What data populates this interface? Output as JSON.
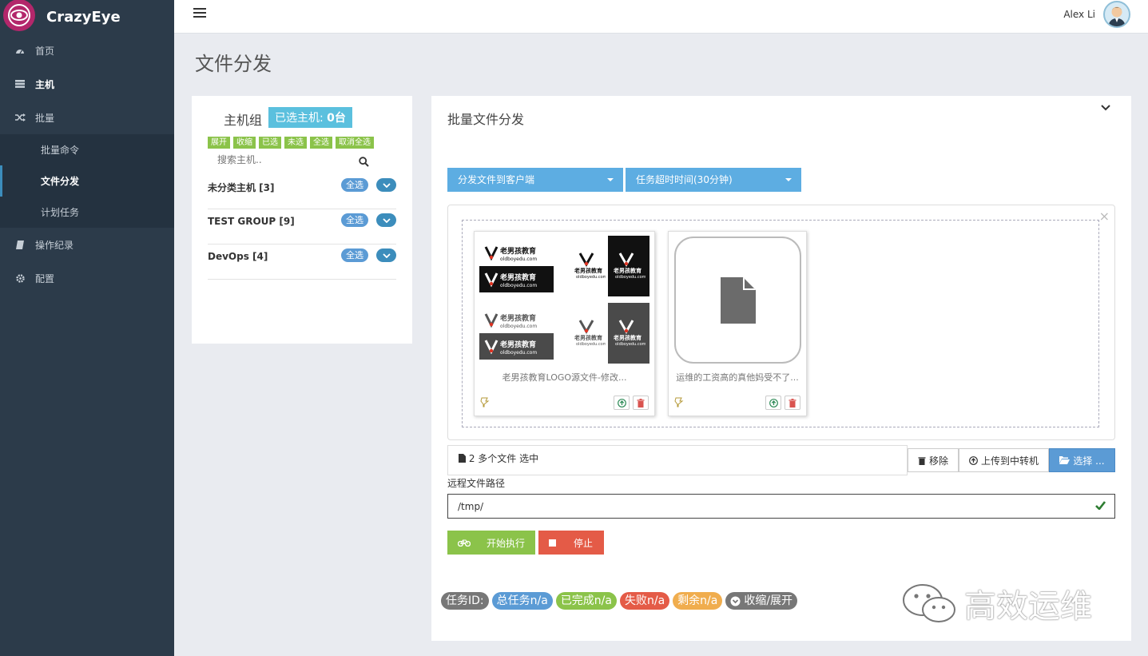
{
  "brand": {
    "name": "CrazyEye",
    "logo_color": "#b3276b"
  },
  "sidebar": {
    "items": [
      {
        "label": "首页",
        "icon": "dashboard-icon"
      },
      {
        "label": "主机",
        "icon": "server-icon"
      },
      {
        "label": "批量",
        "icon": "shuffle-icon"
      },
      {
        "label": "操作纪录",
        "icon": "book-icon"
      },
      {
        "label": "配置",
        "icon": "gear-icon"
      }
    ],
    "sub_items": [
      {
        "label": "批量命令"
      },
      {
        "label": "文件分发"
      },
      {
        "label": "计划任务"
      }
    ]
  },
  "topbar": {
    "user_name": "Alex Li"
  },
  "page": {
    "title": "文件分发"
  },
  "host_panel": {
    "title": "主机组",
    "selected_label": "已选主机:",
    "selected_count": "0台",
    "quick_buttons": [
      "展开",
      "收缩",
      "已选",
      "未选",
      "全选",
      "取消全选"
    ],
    "search_placeholder": "搜索主机..",
    "groups": [
      {
        "name": "未分类主机 [3]",
        "select_all": "全选"
      },
      {
        "name": "TEST GROUP [9]",
        "select_all": "全选"
      },
      {
        "name": "DevOps [4]",
        "select_all": "全选"
      }
    ]
  },
  "main_panel": {
    "title": "批量文件分发",
    "mode_select": "分发文件到客户端",
    "timeout_select": "任务超时时间(30分钟)",
    "files": [
      {
        "caption": "老男孩教育LOGO源文件-修改...",
        "logo_text": "老男孩教育",
        "logo_url": "oldboyedu.com"
      },
      {
        "caption": "运维的工资高的真他妈受不了..."
      }
    ],
    "file_count_text": "2 多个文件 选中",
    "remove_label": "移除",
    "upload_label": "上传到中转机",
    "choose_label": "选择 ...",
    "remote_path_label": "远程文件路径",
    "remote_path_value": "/tmp/",
    "run_label": "开始执行",
    "stop_label": "停止"
  },
  "status": {
    "task_id_label": "任务ID:",
    "total_label": "总任务n/a",
    "done_label": "已完成n/a",
    "failed_label": "失败n/a",
    "remaining_label": "剩余n/a",
    "collapse_label": "收缩/展开"
  },
  "watermark": {
    "text": "高效运维"
  },
  "colors": {
    "sidebar_bg": "#2c3b4a",
    "primary": "#5b9bd5",
    "info": "#5bc0de",
    "success": "#8bc34a",
    "danger": "#e45b47",
    "warning": "#f0ad4e",
    "gray": "#777777"
  }
}
